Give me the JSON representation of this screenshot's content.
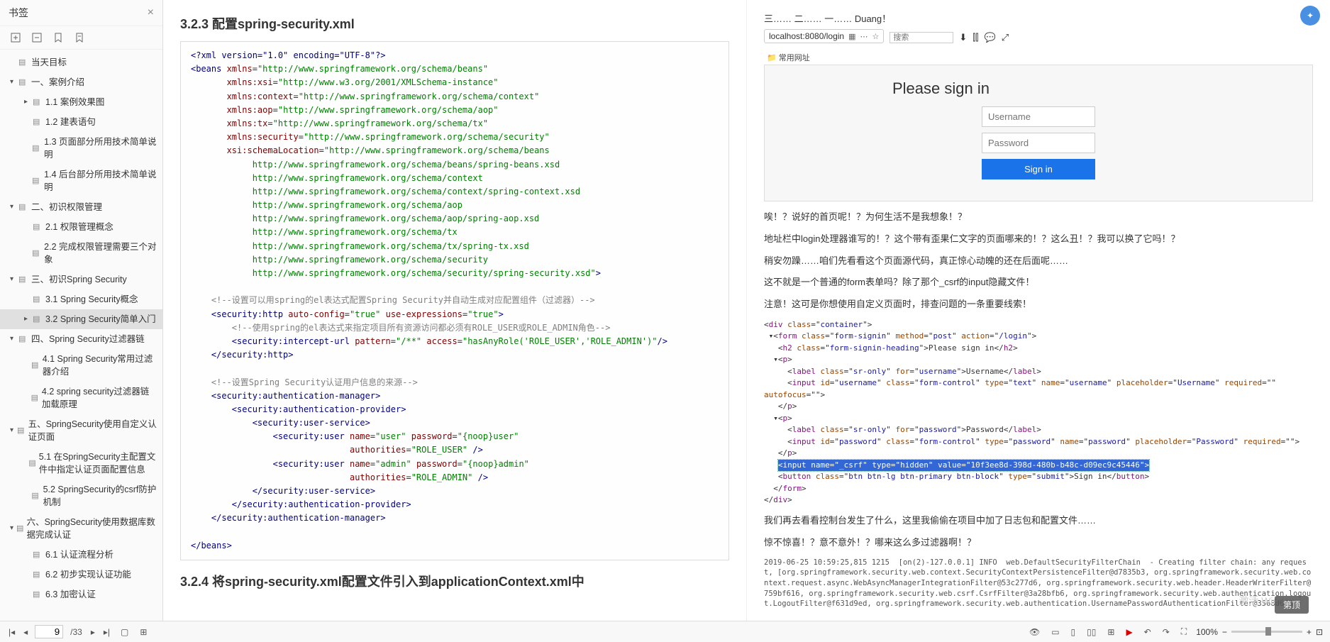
{
  "sidebar": {
    "title": "书签",
    "toc": [
      {
        "lvl": 0,
        "arrow": "",
        "icon": "📄",
        "label": "当天目标"
      },
      {
        "lvl": 1,
        "arrow": "▾",
        "icon": "📄",
        "label": "一、案例介绍"
      },
      {
        "lvl": 2,
        "arrow": "▸",
        "icon": "📄",
        "label": "1.1 案例效果图"
      },
      {
        "lvl": 2,
        "arrow": "",
        "icon": "📄",
        "label": "1.2 建表语句"
      },
      {
        "lvl": 2,
        "arrow": "",
        "icon": "📄",
        "label": "1.3 页面部分所用技术简单说明"
      },
      {
        "lvl": 2,
        "arrow": "",
        "icon": "📄",
        "label": "1.4 后台部分所用技术简单说明"
      },
      {
        "lvl": 1,
        "arrow": "▾",
        "icon": "📄",
        "label": "二、初识权限管理"
      },
      {
        "lvl": 2,
        "arrow": "",
        "icon": "📄",
        "label": "2.1 权限管理概念"
      },
      {
        "lvl": 2,
        "arrow": "",
        "icon": "📄",
        "label": "2.2 完成权限管理需要三个对象"
      },
      {
        "lvl": 1,
        "arrow": "▾",
        "icon": "📄",
        "label": "三、初识Spring Security"
      },
      {
        "lvl": 2,
        "arrow": "",
        "icon": "📄",
        "label": "3.1 Spring Security概念"
      },
      {
        "lvl": 2,
        "arrow": "▸",
        "icon": "📄",
        "label": "3.2 Spring Security简单入门",
        "active": true
      },
      {
        "lvl": 1,
        "arrow": "▾",
        "icon": "📄",
        "label": "四、Spring Security过滤器链"
      },
      {
        "lvl": 2,
        "arrow": "",
        "icon": "📄",
        "label": "4.1 Spring Security常用过滤器介绍"
      },
      {
        "lvl": 2,
        "arrow": "",
        "icon": "📄",
        "label": "4.2 spring security过滤器链加载原理"
      },
      {
        "lvl": 1,
        "arrow": "▾",
        "icon": "📄",
        "label": "五、SpringSecurity使用自定义认证页面"
      },
      {
        "lvl": 2,
        "arrow": "",
        "icon": "📄",
        "label": "5.1 在SpringSecurity主配置文件中指定认证页面配置信息"
      },
      {
        "lvl": 2,
        "arrow": "",
        "icon": "📄",
        "label": "5.2 SpringSecurity的csrf防护机制"
      },
      {
        "lvl": 1,
        "arrow": "▾",
        "icon": "📄",
        "label": "六、SpringSecurity使用数据库数据完成认证"
      },
      {
        "lvl": 2,
        "arrow": "",
        "icon": "📄",
        "label": "6.1 认证流程分析"
      },
      {
        "lvl": 2,
        "arrow": "",
        "icon": "📄",
        "label": "6.2 初步实现认证功能"
      },
      {
        "lvl": 2,
        "arrow": "",
        "icon": "📄",
        "label": "6.3 加密认证"
      }
    ]
  },
  "leftPage": {
    "heading1": "3.2.3 配置spring-security.xml",
    "heading2": "3.2.4 将spring-security.xml配置文件引入到applicationContext.xml中",
    "xml": {
      "decl": "<?xml version=\"1.0\" encoding=\"UTF-8\"?>",
      "beansOpen": "beans",
      "nsLines": [
        {
          "attr": "xmlns",
          "val": "http://www.springframework.org/schema/beans"
        },
        {
          "attr": "xmlns:xsi",
          "val": "http://www.w3.org/2001/XMLSchema-instance"
        },
        {
          "attr": "xmlns:context",
          "val": "http://www.springframework.org/schema/context"
        },
        {
          "attr": "xmlns:aop",
          "val": "http://www.springframework.org/schema/aop"
        },
        {
          "attr": "xmlns:tx",
          "val": "http://www.springframework.org/schema/tx"
        },
        {
          "attr": "xmlns:security",
          "val": "http://www.springframework.org/schema/security"
        }
      ],
      "schemaAttr": "xsi:schemaLocation",
      "schemaLocs": [
        "http://www.springframework.org/schema/beans",
        "http://www.springframework.org/schema/beans/spring-beans.xsd",
        "http://www.springframework.org/schema/context",
        "http://www.springframework.org/schema/context/spring-context.xsd",
        "http://www.springframework.org/schema/aop",
        "http://www.springframework.org/schema/aop/spring-aop.xsd",
        "http://www.springframework.org/schema/tx",
        "http://www.springframework.org/schema/tx/spring-tx.xsd",
        "http://www.springframework.org/schema/security",
        "http://www.springframework.org/schema/security/spring-security.xsd"
      ],
      "comment1": "<!--设置可以用spring的el表达式配置Spring Security并自动生成对应配置组件（过滤器）-->",
      "httpOpen": {
        "tag": "security:http",
        "a1": "auto-config",
        "v1": "true",
        "a2": "use-expressions",
        "v2": "true"
      },
      "comment2": "<!--使用spring的el表达式来指定项目所有资源访问都必须有ROLE_USER或ROLE_ADMIN角色-->",
      "intercept": {
        "tag": "security:intercept-url",
        "a1": "pattern",
        "v1": "/**",
        "a2": "access",
        "v2": "hasAnyRole('ROLE_USER','ROLE_ADMIN')"
      },
      "httpClose": "security:http",
      "comment3": "<!--设置Spring Security认证用户信息的来源-->",
      "authMgr": "security:authentication-manager",
      "authProv": "security:authentication-provider",
      "userSvc": "security:user-service",
      "user1": {
        "tag": "security:user",
        "name": "user",
        "pwd": "{noop}user",
        "auth": "ROLE_USER"
      },
      "user2": {
        "tag": "security:user",
        "name": "admin",
        "pwd": "{noop}admin",
        "auth": "ROLE_ADMIN"
      },
      "beansClose": "beans"
    }
  },
  "rightPage": {
    "tabs": "三…… 二…… 一…… Duang！",
    "url": "localhost:8080/login",
    "searchPlaceholder": "搜索",
    "bookmarkBar": "📁 常用网址",
    "login": {
      "heading": "Please sign in",
      "ph1": "Username",
      "ph2": "Password",
      "btn": "Sign in"
    },
    "paras": [
      "唉！？说好的首页呢！？为何生活不是我想象！？",
      "地址栏中login处理器谁写的！？这个带有歪果仁文字的页面哪来的！？这么丑！？我可以换了它吗！？",
      "稍安勿躁……咱们先看看这个页面源代码，真正惊心动魄的还在后面呢……",
      "这不就是一个普通的form表单吗？除了那个_csrf的input隐藏文件！",
      "注意！这可是你想使用自定义页面时，排查问题的一条重要线索！"
    ],
    "dev": {
      "div": {
        "cls": "container"
      },
      "form": {
        "cls": "form-signin",
        "method": "post",
        "action": "/login"
      },
      "h2": {
        "cls": "form-signin-heading",
        "txt": "Please sign in"
      },
      "lbl1": {
        "cls": "sr-only",
        "for": "username",
        "txt": "Username"
      },
      "in1": {
        "id": "username",
        "cls": "form-control",
        "type": "text",
        "name": "username",
        "ph": "Username",
        "req": "",
        "af": ""
      },
      "lbl2": {
        "cls": "sr-only",
        "for": "password",
        "txt": "Password"
      },
      "in2": {
        "id": "password",
        "cls": "form-control",
        "type": "password",
        "name": "password",
        "ph": "Password",
        "req": ""
      },
      "csrf": {
        "name": "_csrf",
        "type": "hidden",
        "value": "10f3ee8d-398d-480b-b48c-d09ec9c45446"
      },
      "btn": {
        "cls": "btn btn-lg btn-primary btn-block",
        "type": "submit",
        "txt": "Sign in"
      }
    },
    "para6": "我们再去看看控制台发生了什么，这里我偷偷在项目中加了日志包和配置文件……",
    "para7": "惊不惊喜！？意不意外！？哪来这么多过滤器啊！？",
    "log": "2019-06-25 10:59:25,815 1215  [on(2)-127.0.0.1] INFO  web.DefaultSecurityFilterChain  - Creating filter chain: any request, [org.springframework.security.web.context.SecurityContextPersistenceFilter@d7835b3, org.springframework.security.web.context.request.async.WebAsyncManagerIntegrationFilter@53c277d6, org.springframework.security.web.header.HeaderWriterFilter@759bf616, org.springframework.security.web.csrf.CsrfFilter@3a28bfb6, org.springframework.security.web.authentication.logout.LogoutFilter@f631d9ed, org.springframework.security.web.authentication.UsernamePasswordAuthenticationFilter@3568d653,"
  },
  "bottom": {
    "page": "9",
    "total": "/33",
    "zoom": "100%"
  },
  "pill": "第顶",
  "watermark": "激活 Windows"
}
